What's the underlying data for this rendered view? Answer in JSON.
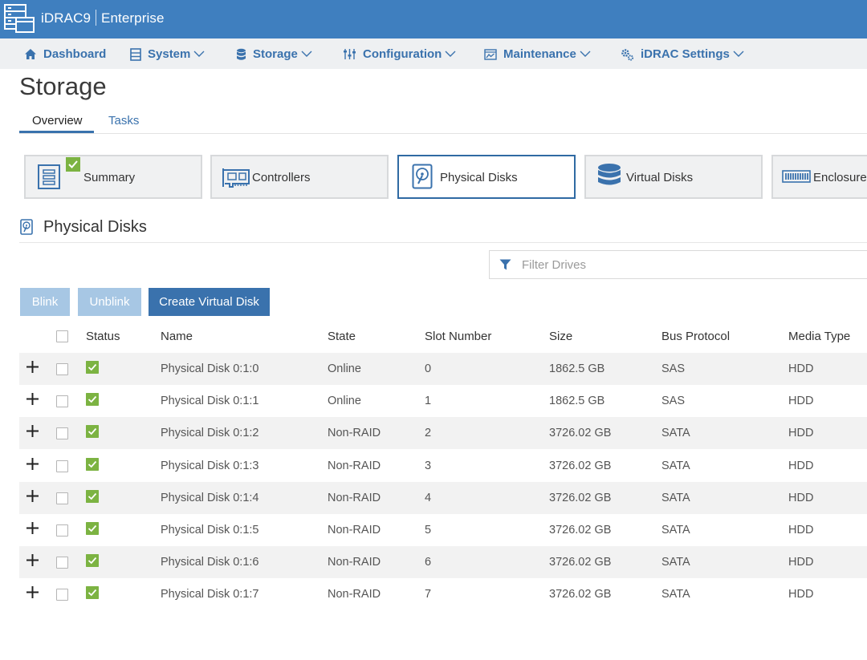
{
  "app": {
    "product": "iDRAC9",
    "edition": "Enterprise"
  },
  "nav": {
    "dashboard": "Dashboard",
    "system": "System",
    "storage": "Storage",
    "configuration": "Configuration",
    "maintenance": "Maintenance",
    "idrac_settings": "iDRAC Settings"
  },
  "page": {
    "title": "Storage"
  },
  "tabs": {
    "overview": "Overview",
    "tasks": "Tasks",
    "active": "Overview"
  },
  "cards": {
    "summary": "Summary",
    "controllers": "Controllers",
    "physical_disks": "Physical Disks",
    "virtual_disks": "Virtual Disks",
    "enclosures": "Enclosure",
    "active": "Physical Disks"
  },
  "section": {
    "title": "Physical Disks"
  },
  "filter": {
    "placeholder": "Filter Drives",
    "value": ""
  },
  "actions": {
    "blink": "Blink",
    "unblink": "Unblink",
    "create_vd": "Create Virtual Disk"
  },
  "table": {
    "columns": {
      "status": "Status",
      "name": "Name",
      "state": "State",
      "slot": "Slot Number",
      "size": "Size",
      "bus": "Bus Protocol",
      "media": "Media Type"
    },
    "rows": [
      {
        "name": "Physical Disk 0:1:0",
        "state": "Online",
        "slot": "0",
        "size": "1862.5 GB",
        "bus": "SAS",
        "media": "HDD"
      },
      {
        "name": "Physical Disk 0:1:1",
        "state": "Online",
        "slot": "1",
        "size": "1862.5 GB",
        "bus": "SAS",
        "media": "HDD"
      },
      {
        "name": "Physical Disk 0:1:2",
        "state": "Non-RAID",
        "slot": "2",
        "size": "3726.02 GB",
        "bus": "SATA",
        "media": "HDD"
      },
      {
        "name": "Physical Disk 0:1:3",
        "state": "Non-RAID",
        "slot": "3",
        "size": "3726.02 GB",
        "bus": "SATA",
        "media": "HDD"
      },
      {
        "name": "Physical Disk 0:1:4",
        "state": "Non-RAID",
        "slot": "4",
        "size": "3726.02 GB",
        "bus": "SATA",
        "media": "HDD"
      },
      {
        "name": "Physical Disk 0:1:5",
        "state": "Non-RAID",
        "slot": "5",
        "size": "3726.02 GB",
        "bus": "SATA",
        "media": "HDD"
      },
      {
        "name": "Physical Disk 0:1:6",
        "state": "Non-RAID",
        "slot": "6",
        "size": "3726.02 GB",
        "bus": "SATA",
        "media": "HDD"
      },
      {
        "name": "Physical Disk 0:1:7",
        "state": "Non-RAID",
        "slot": "7",
        "size": "3726.02 GB",
        "bus": "SATA",
        "media": "HDD"
      }
    ]
  },
  "colors": {
    "header_blue": "#3f7fbf",
    "link_blue": "#3a72ad",
    "status_ok_green": "#7cb342",
    "disabled_button": "#a7c7e4"
  },
  "icons": {
    "logo": "server-rack-icon",
    "dashboard": "home-icon",
    "system": "server-icon",
    "storage": "database-icon",
    "configuration": "sliders-icon",
    "maintenance": "chart-window-icon",
    "idrac_settings": "gears-icon",
    "filter": "funnel-icon",
    "row_status": "check-icon",
    "expand": "plus-icon"
  }
}
